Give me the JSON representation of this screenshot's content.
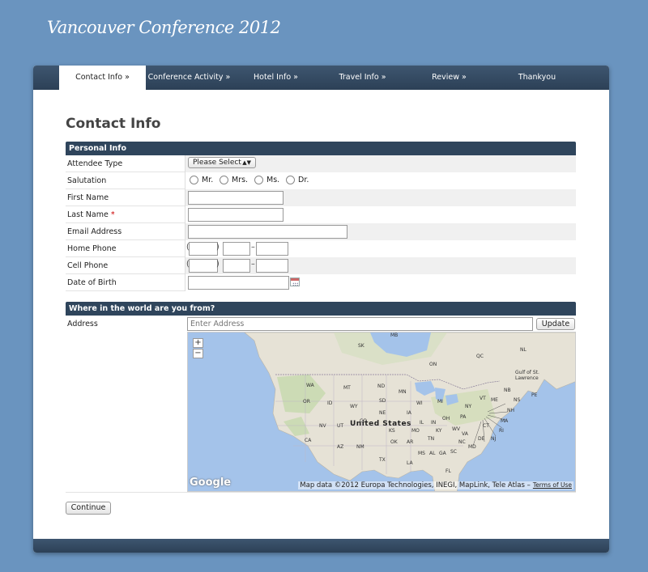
{
  "site": {
    "title": "Vancouver Conference 2012"
  },
  "nav": {
    "tabs": [
      {
        "label": "Contact Info »",
        "active": true
      },
      {
        "label": "Conference Activity »",
        "active": false
      },
      {
        "label": "Hotel Info »",
        "active": false
      },
      {
        "label": "Travel Info »",
        "active": false
      },
      {
        "label": "Review »",
        "active": false
      },
      {
        "label": "Thankyou",
        "active": false
      }
    ]
  },
  "page": {
    "heading": "Contact Info"
  },
  "personal": {
    "section_title": "Personal Info",
    "attendee_type": {
      "label": "Attendee Type",
      "value": "Please Select"
    },
    "salutation": {
      "label": "Salutation",
      "options": [
        "Mr.",
        "Mrs.",
        "Ms.",
        "Dr."
      ]
    },
    "first_name": {
      "label": "First Name",
      "value": ""
    },
    "last_name": {
      "label": "Last Name",
      "required_mark": "*",
      "value": ""
    },
    "email": {
      "label": "Email Address",
      "value": ""
    },
    "home_phone": {
      "label": "Home Phone",
      "paren_open": "(",
      "paren_close": ")",
      "dash": "–"
    },
    "cell_phone": {
      "label": "Cell Phone",
      "paren_open": "(",
      "paren_close": ")",
      "dash": "–"
    },
    "dob": {
      "label": "Date of Birth",
      "value": ""
    }
  },
  "location": {
    "section_title": "Where in the world are you from?",
    "address_label": "Address",
    "address_placeholder": "Enter Address",
    "update_label": "Update",
    "map": {
      "country_label": "United States",
      "credit": "Map data ©2012 Europa Technologies, INEGI, MapLink, Tele Atlas –",
      "terms": "Terms of Use",
      "logo": "Google",
      "zoom_in": "+",
      "zoom_out": "−",
      "region_labels": [
        "MB",
        "SK",
        "ON",
        "QC",
        "NL",
        "WA",
        "MT",
        "ND",
        "MN",
        "OR",
        "ID",
        "WY",
        "SD",
        "WI",
        "MI",
        "NY",
        "VT",
        "ME",
        "NH",
        "MA",
        "CT",
        "RI",
        "NV",
        "UT",
        "CO",
        "NE",
        "IA",
        "IL",
        "IN",
        "OH",
        "PA",
        "NJ",
        "DE",
        "MD",
        "CA",
        "AZ",
        "NM",
        "OK",
        "AR",
        "TN",
        "KY",
        "WV",
        "VA",
        "NC",
        "SC",
        "GA",
        "AL",
        "MS",
        "LA",
        "TX",
        "FL",
        "NB",
        "NS",
        "PE",
        "KS",
        "MO"
      ],
      "gulf_label": "Gulf of St. Lawrence"
    }
  },
  "actions": {
    "continue_label": "Continue"
  }
}
